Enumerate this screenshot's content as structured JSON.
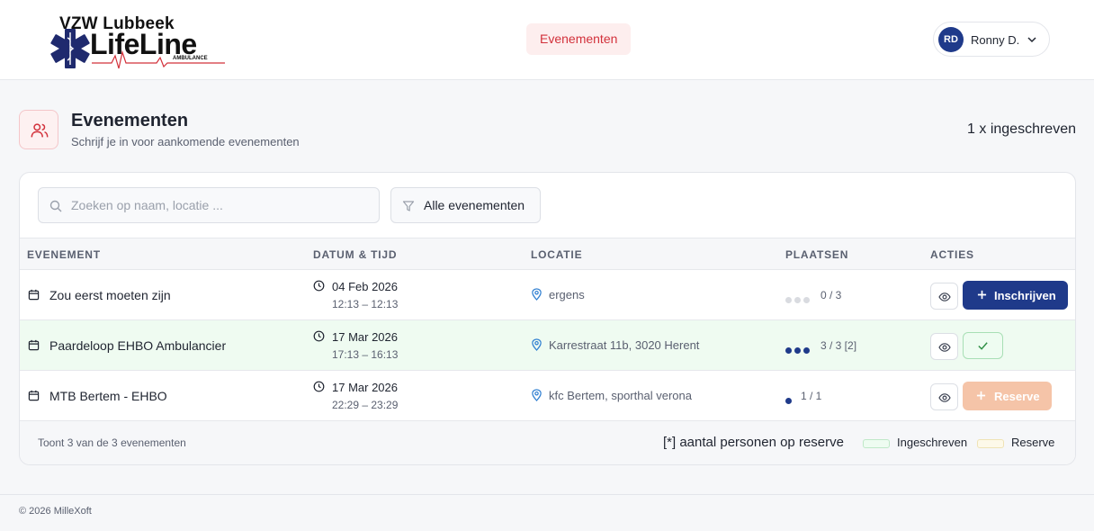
{
  "brand": {
    "title": "VZW Lubbeek",
    "word": "LifeLine",
    "sub": "AMBULANCE"
  },
  "nav": {
    "active_label": "Evenementen"
  },
  "user": {
    "initials": "RD",
    "name": "Ronny D."
  },
  "page": {
    "title": "Evenementen",
    "subtitle": "Schrijf je in voor aankomende evenementen",
    "registered_count": "1 x ingeschreven"
  },
  "toolbar": {
    "search_placeholder": "Zoeken op naam, locatie ...",
    "filter_label": "Alle evenementen"
  },
  "table": {
    "headers": [
      "EVENEMENT",
      "DATUM & TIJD",
      "LOCATIE",
      "PLAATSEN",
      "ACTIES"
    ],
    "rows": [
      {
        "name": "Zou eerst moeten zijn",
        "date": "04 Feb 2026",
        "time": "12:13 – 12:13",
        "location": "ergens",
        "places": "0 / 3",
        "filled": 0,
        "total": 3,
        "action": "Inschrijven",
        "status": "open"
      },
      {
        "name": "Paardeloop EHBO Ambulancier",
        "date": "17 Mar 2026",
        "time": "17:13 – 16:13",
        "location": "Karrestraat 11b, 3020 Herent",
        "places": "3 / 3 [2]",
        "filled": 3,
        "total": 3,
        "action": "",
        "status": "registered"
      },
      {
        "name": "MTB Bertem - EHBO",
        "date": "17 Mar 2026",
        "time": "22:29 – 23:29",
        "location": "kfc Bertem, sporthal verona",
        "places": "1 / 1",
        "filled": 1,
        "total": 1,
        "action": "Reserve",
        "status": "reserve"
      }
    ]
  },
  "footer": {
    "count_text": "Toont 3 van de 3 evenementen",
    "note": "[*] aantal personen op reserve",
    "legend_registered": "Ingeschreven",
    "legend_reserve": "Reserve"
  },
  "copyright": "© 2026 MilleXoft",
  "colors": {
    "primary": "#1f3a8a",
    "accent_red": "#d2313b",
    "registered_bg": "#effbf1",
    "reserve_btn": "#f5c4a8",
    "dot_empty": "#d9dbe0"
  }
}
